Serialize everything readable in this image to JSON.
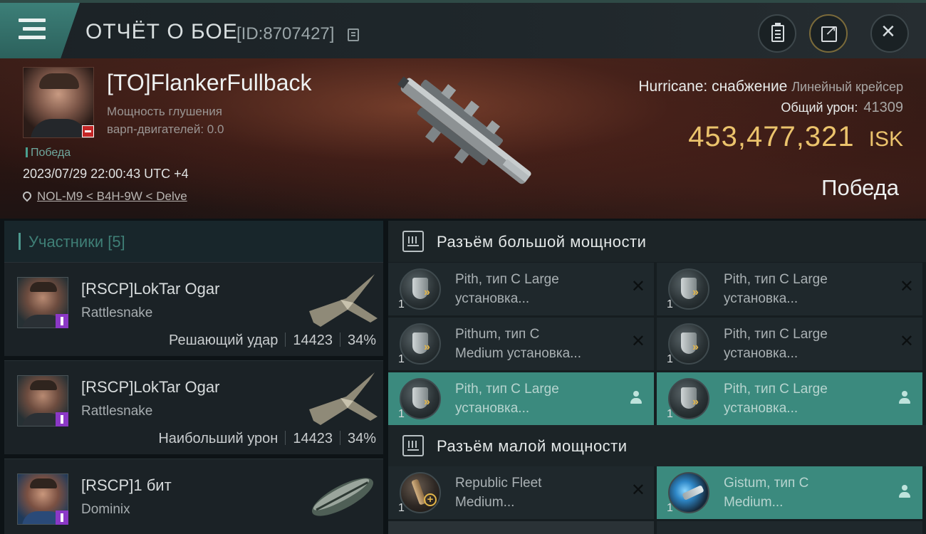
{
  "header": {
    "title": "ОТЧЁТ О БОЕ",
    "report_id": "[ID:8707427]"
  },
  "victim": {
    "name": "[TO]FlankerFullback",
    "sub_line1": "Мощность глушения",
    "sub_line2": "варп-двигателей: 0.0",
    "result_small": "Победа",
    "datetime": "2023/07/29 22:00:43 UTC +4",
    "location": "NOL-M9 < B4H-9W < Delve",
    "ship_name": "Hurricane: снабжение",
    "ship_class": "Линейный крейсер",
    "total_damage_label": "Общий урон:",
    "total_damage_value": "41309",
    "isk_value": "453,477,321",
    "isk_unit": "ISK",
    "result_big": "Победа"
  },
  "participants": {
    "header": "Участники [5]",
    "items": [
      {
        "name": "[RSCP]LokTar Ogar",
        "ship": "Rattlesnake",
        "role": "Решающий удар",
        "damage": "14423",
        "percent": "34%"
      },
      {
        "name": "[RSCP]LokTar Ogar",
        "ship": "Rattlesnake",
        "role": "Наибольший урон",
        "damage": "14423",
        "percent": "34%"
      },
      {
        "name": "[RSCP]1 бит",
        "ship": "Dominix",
        "role": "",
        "damage": "",
        "percent": ""
      }
    ]
  },
  "fitting": {
    "high_title": "Разъём большой мощности",
    "low_title": "Разъём малой мощности",
    "high_slots": [
      {
        "line1": "Pith, тип C Large",
        "line2": "установка...",
        "qty": "1",
        "state": "destroyed"
      },
      {
        "line1": "Pith, тип C Large",
        "line2": "установка...",
        "qty": "1",
        "state": "destroyed"
      },
      {
        "line1": "Pithum, тип C",
        "line2": "Medium установка...",
        "qty": "1",
        "state": "destroyed"
      },
      {
        "line1": "Pith, тип C Large",
        "line2": "установка...",
        "qty": "1",
        "state": "destroyed"
      },
      {
        "line1": "Pith, тип C Large",
        "line2": "установка...",
        "qty": "1",
        "state": "dropped"
      },
      {
        "line1": "Pith, тип C Large",
        "line2": "установка...",
        "qty": "1",
        "state": "dropped"
      }
    ],
    "low_slots": [
      {
        "line1": "Republic Fleet",
        "line2": "Medium...",
        "qty": "1",
        "state": "destroyed"
      },
      {
        "line1": "Gistum, тип C",
        "line2": "Medium...",
        "qty": "1",
        "state": "dropped"
      }
    ]
  },
  "colors": {
    "accent_teal": "#3b8a7e",
    "isk_gold": "#ebc36c",
    "banner_red": "#3a1e18",
    "badge_purple": "#8b38c6",
    "minus_red": "#c42626"
  }
}
